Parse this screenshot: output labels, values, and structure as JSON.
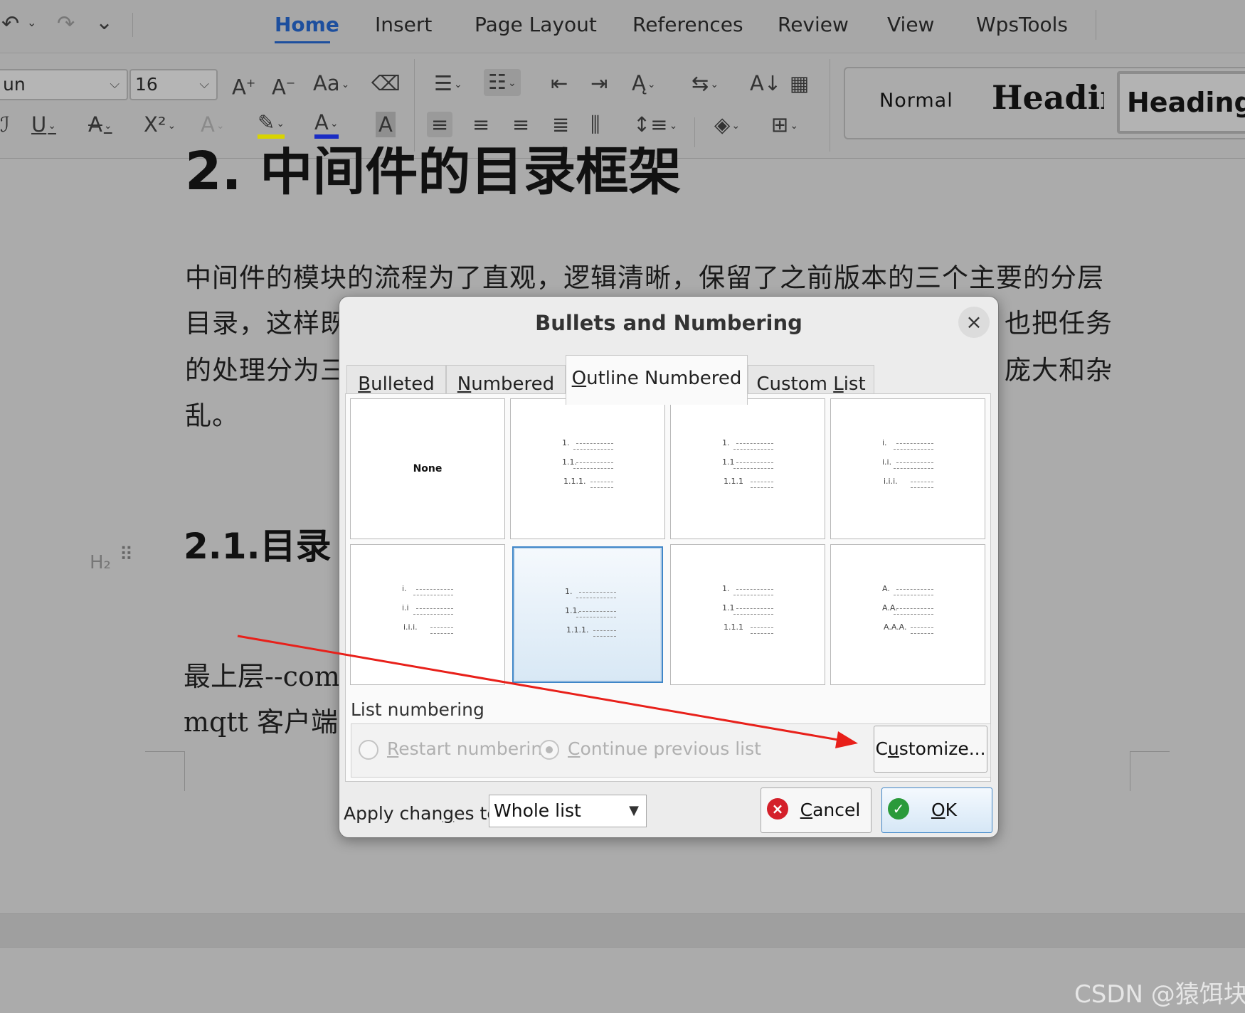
{
  "quick_access": {
    "undo": "↶",
    "redo": "↷",
    "more": "⌄"
  },
  "menu_tabs": [
    "Home",
    "Insert",
    "Page Layout",
    "References",
    "Review",
    "View",
    "WpsTools"
  ],
  "toolbar": {
    "font_name": "un",
    "font_size": "16",
    "styles": {
      "normal": "Normal",
      "heading1": "Heading",
      "heading2": "Heading"
    }
  },
  "document": {
    "h1": "2. 中间件的目录框架",
    "para_lines": [
      "中间件的模块的流程为了直观，逻辑清晰，保留了之前版本的三个主要的分层",
      "目录，这样既",
      "的处理分为三",
      "乱。"
    ],
    "para_right": [
      "也把任务",
      "庞大和杂"
    ],
    "h2": "2.1.目录",
    "h2_marker": "H₂",
    "line1": "最上层--comi",
    "line2": "mqtt 客户端"
  },
  "dialog": {
    "title": "Bullets and Numbering",
    "close": "×",
    "tabs": [
      "Bulleted",
      "Numbered",
      "Outline Numbered",
      "Custom List"
    ],
    "active_tab": "Outline Numbered",
    "none_label": "None",
    "previews": [
      [
        "1.",
        "1.1.",
        "1.1.1."
      ],
      [
        "1.",
        "1.1",
        "1.1.1"
      ],
      [
        "i.",
        "i.i.",
        "i.i.i."
      ],
      [
        "i.",
        "i.i",
        "i.i.i."
      ],
      [
        "1.",
        "1.1.",
        "1.1.1."
      ],
      [
        "1.",
        "1.1",
        "1.1.1"
      ],
      [
        "A.",
        "A.A.",
        "A.A.A."
      ]
    ],
    "selected_cell": 5,
    "list_numbering_label": "List numbering",
    "restart_label": "Restart numbering",
    "continue_label": "Continue previous list",
    "customize_label": "Customize...",
    "apply_label": "Apply changes to:",
    "apply_value": "Whole list",
    "cancel_label": "Cancel",
    "ok_label": "OK"
  },
  "watermark": "CSDN @猿饵块",
  "colors": {
    "accent": "#1d4f9e",
    "selection": "#3f86c8",
    "annotation_arrow": "#e8201a",
    "cancel_icon": "#d4202a",
    "ok_icon": "#2a9a3a"
  }
}
